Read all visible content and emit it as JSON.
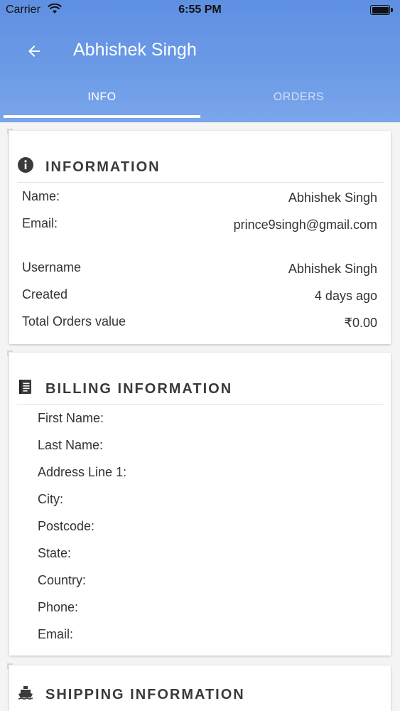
{
  "status_bar": {
    "carrier": "Carrier",
    "time": "6:55 PM"
  },
  "header": {
    "title": "Abhishek Singh",
    "back_icon": "arrow-left-icon"
  },
  "tabs": [
    {
      "label": "INFO",
      "active": true
    },
    {
      "label": "ORDERS",
      "active": false
    }
  ],
  "information": {
    "title": "INFORMATION",
    "icon": "info-circle-icon",
    "rows": [
      {
        "label": "Name:",
        "value": "Abhishek Singh"
      },
      {
        "label": "Email:",
        "value": "prince9singh@gmail.com"
      },
      {
        "label": "Username",
        "value": "Abhishek Singh"
      },
      {
        "label": "Created",
        "value": "4 days ago"
      },
      {
        "label": "Total Orders value",
        "value": "₹0.00"
      }
    ]
  },
  "billing": {
    "title": "BILLING INFORMATION",
    "icon": "book-icon",
    "fields": [
      {
        "label": "First Name:"
      },
      {
        "label": "Last Name:"
      },
      {
        "label": "Address Line 1:"
      },
      {
        "label": "City:"
      },
      {
        "label": "Postcode:"
      },
      {
        "label": "State:"
      },
      {
        "label": "Country:"
      },
      {
        "label": "Phone:"
      },
      {
        "label": "Email:"
      }
    ]
  },
  "shipping": {
    "title": "SHIPPING INFORMATION",
    "icon": "ship-icon"
  },
  "colors": {
    "header_gradient_top": "#5f8fe2",
    "header_gradient_bottom": "#7aa6ea",
    "tab_active": "#ffffff"
  }
}
